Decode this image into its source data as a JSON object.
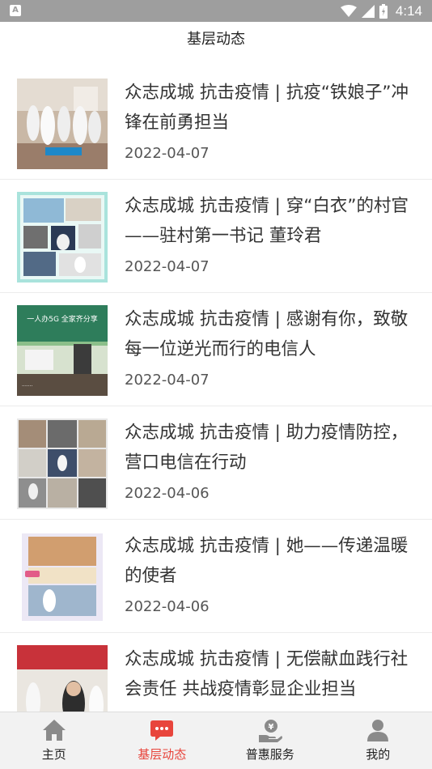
{
  "status_bar": {
    "sim_label": "A",
    "time": "4:14"
  },
  "header": {
    "title": "基层动态"
  },
  "news": [
    {
      "headline": "众志成城 抗击疫情 | 抗疫“铁娘子”冲锋在前勇担当",
      "date": "2022-04-07"
    },
    {
      "headline": "众志成城 抗击疫情 | 穿“白衣”的村官——驻村第一书记 董玲君",
      "date": "2022-04-07"
    },
    {
      "headline": "众志成城 抗击疫情 | 感谢有你，致敬每一位逆光而行的电信人",
      "date": "2022-04-07"
    },
    {
      "headline": "众志成城 抗击疫情 | 助力疫情防控，营口电信在行动",
      "date": "2022-04-06"
    },
    {
      "headline": "众志成城 抗击疫情 | 她——传递温暖的使者",
      "date": "2022-04-06"
    },
    {
      "headline": "众志成城 抗击疫情 | 无偿献血践行社会责任 共战疫情彰显企业担当",
      "date": ""
    }
  ],
  "tabs": [
    {
      "label": "主页",
      "icon": "home-icon",
      "active": false
    },
    {
      "label": "基层动态",
      "icon": "message-icon",
      "active": true
    },
    {
      "label": "普惠服务",
      "icon": "service-icon",
      "active": false
    },
    {
      "label": "我的",
      "icon": "profile-icon",
      "active": false
    }
  ],
  "colors": {
    "accent": "#e8453c",
    "tab_icon": "#8a8a8a"
  },
  "thumb_content": {
    "thumb_3_banner": "一人办5G 全家齐分享"
  }
}
